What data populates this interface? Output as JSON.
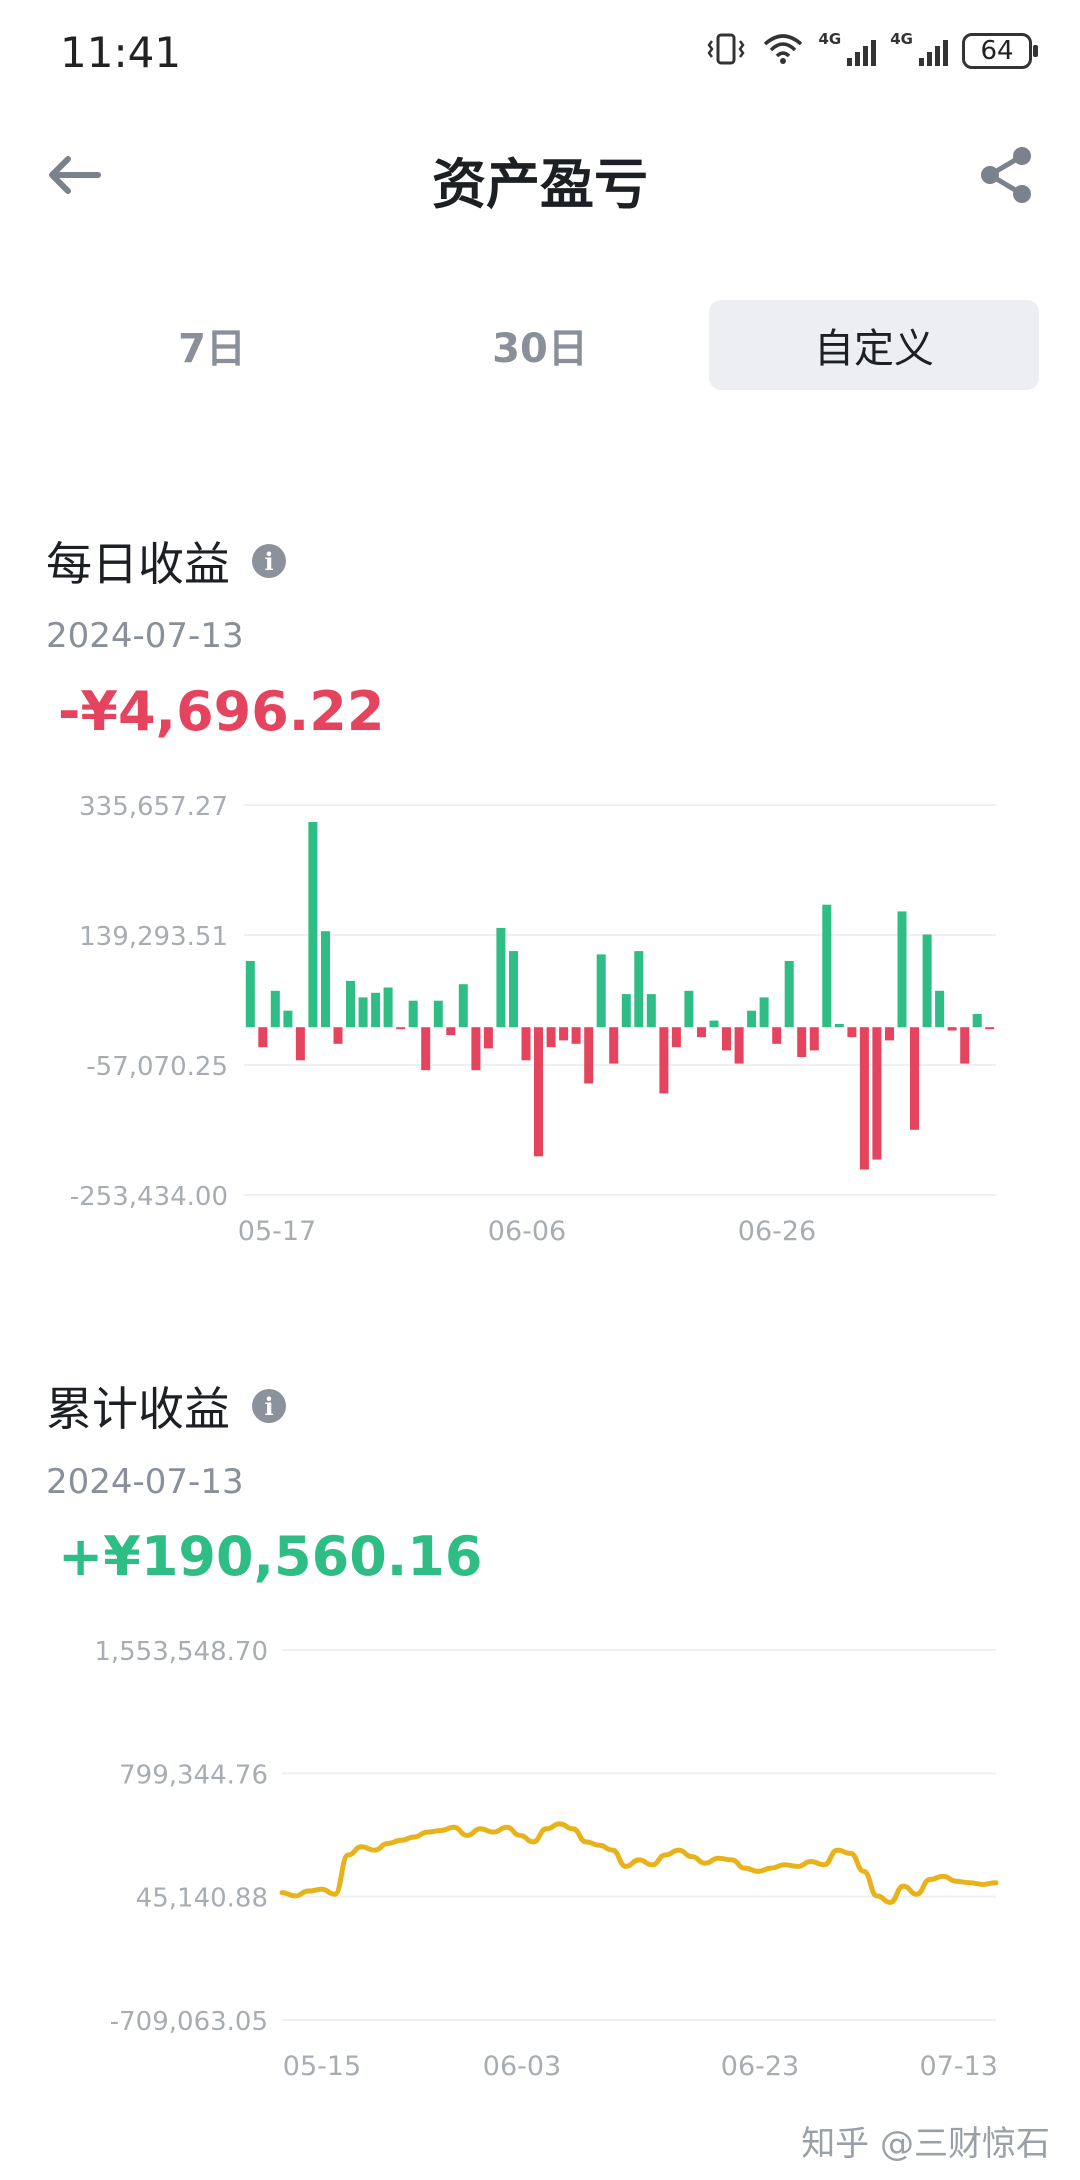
{
  "status_bar": {
    "time": "11:41",
    "battery": "64",
    "network1": "4G",
    "network2": "4G"
  },
  "header": {
    "title": "资产盈亏",
    "back_icon": "arrow-left-icon",
    "share_icon": "share-icon"
  },
  "tabs": [
    {
      "label": "7日",
      "active": false
    },
    {
      "label": "30日",
      "active": false
    },
    {
      "label": "自定义",
      "active": true
    }
  ],
  "daily": {
    "title": "每日收益",
    "date": "2024-07-13",
    "amount": "-¥4,696.22",
    "colors": {
      "positive": "#2ebd85",
      "negative": "#e5445e"
    }
  },
  "cumulative": {
    "title": "累计收益",
    "date": "2024-07-13",
    "amount": "+¥190,560.16",
    "color": "#e8b21a"
  },
  "watermark": "知乎 @三财惊石",
  "chart_data": [
    {
      "type": "bar",
      "y_ticks": [
        "335,657.27",
        "139,293.51",
        "-57,070.25",
        "-253,434.00"
      ],
      "x_ticks": [
        "05-17",
        "06-06",
        "06-26"
      ],
      "ylim": [
        -253434,
        335657.27
      ],
      "values": [
        100000,
        -30000,
        55000,
        25000,
        -50000,
        310000,
        145000,
        -25000,
        70000,
        45000,
        52000,
        60000,
        -2000,
        40000,
        -65000,
        40000,
        -12000,
        65000,
        -65000,
        -32000,
        150000,
        115000,
        -50000,
        -195000,
        -30000,
        -20000,
        -25000,
        -85000,
        110000,
        -55000,
        50000,
        115000,
        50000,
        -100000,
        -30000,
        55000,
        -15000,
        10000,
        -35000,
        -55000,
        25000,
        45000,
        -25000,
        100000,
        -45000,
        -35000,
        185000,
        5000,
        -15000,
        -215000,
        -200000,
        -20000,
        175000,
        -155000,
        140000,
        55000,
        -5000,
        -55000,
        20000,
        -3000
      ]
    },
    {
      "type": "line",
      "y_ticks": [
        "1,553,548.70",
        "799,344.76",
        "45,140.88",
        "-709,063.05"
      ],
      "x_ticks": [
        "05-15",
        "06-03",
        "06-23",
        "07-13"
      ],
      "ylim": [
        -709063.05,
        1553548.7
      ],
      "values": [
        70000,
        50000,
        80000,
        90000,
        60000,
        300000,
        350000,
        330000,
        370000,
        390000,
        410000,
        440000,
        450000,
        470000,
        420000,
        460000,
        440000,
        470000,
        420000,
        380000,
        460000,
        490000,
        460000,
        380000,
        360000,
        330000,
        230000,
        270000,
        240000,
        300000,
        330000,
        290000,
        250000,
        280000,
        270000,
        220000,
        200000,
        220000,
        240000,
        230000,
        260000,
        240000,
        330000,
        310000,
        200000,
        50000,
        10000,
        110000,
        60000,
        150000,
        170000,
        140000,
        130000,
        120000,
        130000
      ]
    }
  ]
}
